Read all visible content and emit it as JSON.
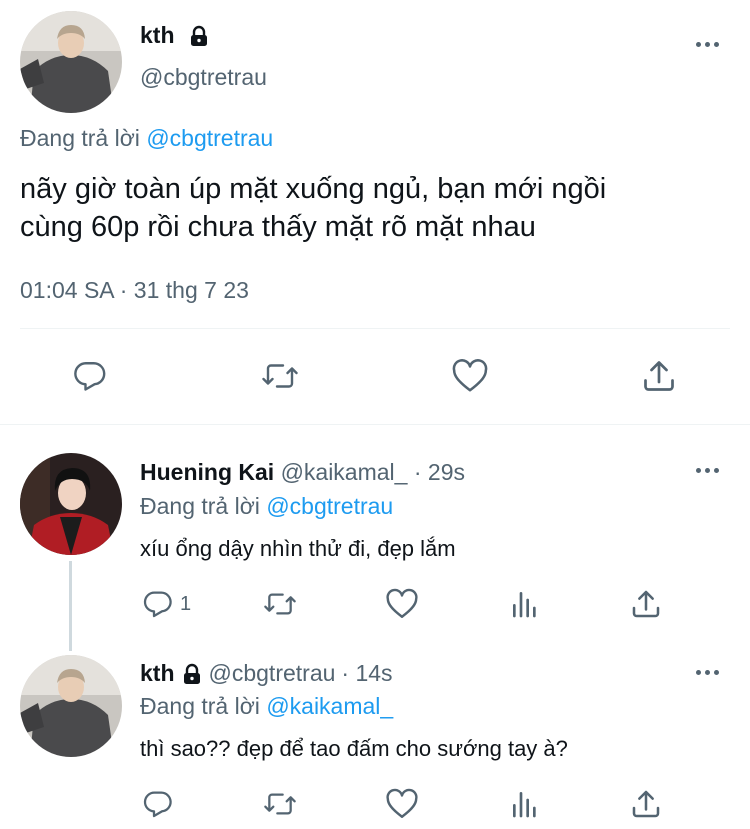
{
  "main_tweet": {
    "author_name": "kth",
    "author_handle": "@cbgtretrau",
    "reply_prefix": "Đang trả lời",
    "reply_to": "@cbgtretrau",
    "text_line1": "nãy giờ toàn úp mặt xuống ngủ, bạn mới ngồi",
    "text_line2": "cùng 60p rồi chưa thấy mặt rõ mặt nhau",
    "timestamp": "01:04 SA · 31 thg 7 23",
    "icons": [
      "reply-icon",
      "retweet-icon",
      "like-icon",
      "share-icon"
    ]
  },
  "replies": [
    {
      "author_name": "Huening Kai",
      "author_handle": "@kaikamal_",
      "time": "· 29s",
      "reply_prefix": "Đang trả lời",
      "reply_to": "@cbgtretrau",
      "text": "xíu ổng dậy nhìn thử đi, đẹp lắm",
      "reply_count": "1"
    },
    {
      "author_name": "kth",
      "author_handle": "@cbgtretrau",
      "time": "· 14s",
      "reply_prefix": "Đang trả lời",
      "reply_to": "@kaikamal_",
      "text": "thì sao?? đẹp để tao đấm cho sướng tay à?",
      "reply_count": ""
    }
  ],
  "colors": {
    "accent": "#1d9bf0",
    "text": "#0f1419",
    "muted": "#536471",
    "divider": "#eff3f4"
  }
}
